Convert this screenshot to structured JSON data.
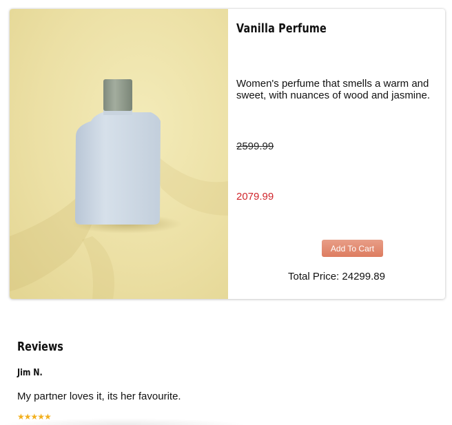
{
  "product": {
    "title": "Vanilla Perfume",
    "description": "Women's perfume that smells a warm and sweet, with nuances of wood and jasmine.",
    "original_price": "2599.99",
    "sale_price": "2079.99",
    "add_to_cart_label": "Add To Cart",
    "total_price_label": "Total Price: 24299.89",
    "image_icon": "perfume-bottle-photo"
  },
  "reviews": {
    "heading": "Reviews",
    "items": [
      {
        "author": "Jim N.",
        "text": "My partner loves it, its her favourite.",
        "rating": 5,
        "stars_display": "★★★★★"
      }
    ]
  },
  "colors": {
    "sale_price": "#d0262c",
    "button": "#e28a6f",
    "star": "#f2b01e",
    "photo_background": "#ece0a5"
  }
}
